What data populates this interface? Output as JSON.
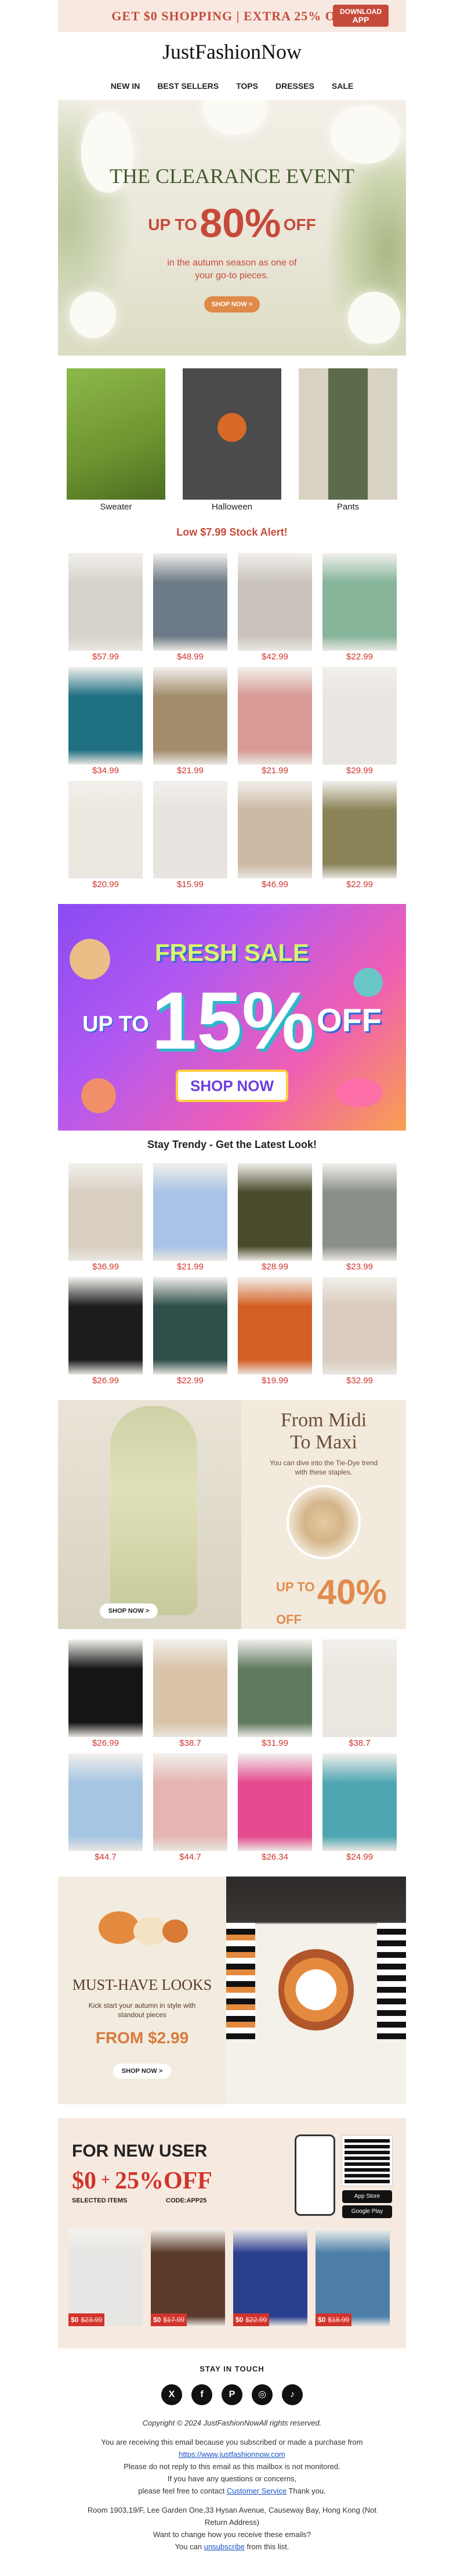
{
  "topbar": {
    "promo": "GET $0 SHOPPING | EXTRA 25% OFF",
    "download_line1": "DOWNLOAD",
    "download_line2": "APP"
  },
  "brand": "JustFashionNow",
  "nav": [
    "NEW IN",
    "BEST SELLERS",
    "TOPS",
    "DRESSES",
    "SALE"
  ],
  "hero": {
    "title": "THE CLEARANCE EVENT",
    "upto": "UP TO",
    "percent": "80%",
    "off": "OFF",
    "subtitle_1": "in the autumn season as one of",
    "subtitle_2": "your go-to pieces.",
    "button": "SHOP NOW >"
  },
  "categories": [
    {
      "label": "Sweater",
      "color": "#7aa238"
    },
    {
      "label": "Halloween",
      "color": "#4b4a4c"
    },
    {
      "label": "Pants",
      "color": "#5e6a4c"
    }
  ],
  "stock_alert": "Low $7.99 Stock Alert!",
  "stock_products": [
    {
      "price": "$57.99",
      "color": "#d7d3cc"
    },
    {
      "price": "$48.99",
      "color": "#6b7a86"
    },
    {
      "price": "$42.99",
      "color": "#c9c3bc"
    },
    {
      "price": "$22.99",
      "color": "#86b59a"
    },
    {
      "price": "$34.99",
      "color": "#1f6f83"
    },
    {
      "price": "$21.99",
      "color": "#a38c6c"
    },
    {
      "price": "$21.99",
      "color": "#d89a95"
    },
    {
      "price": "$29.99",
      "color": "#e9e5e1"
    },
    {
      "price": "$20.99",
      "color": "#ede8df"
    },
    {
      "price": "$15.99",
      "color": "#e7e4df"
    },
    {
      "price": "$46.99",
      "color": "#cbb9a3"
    },
    {
      "price": "$22.99",
      "color": "#8a8358"
    }
  ],
  "fresh_sale": {
    "title": "FRESH SALE",
    "upto": "UP TO",
    "percent": "15%",
    "off": "OFF",
    "button": "SHOP NOW"
  },
  "trendy_heading": "Stay Trendy - Get the Latest Look!",
  "trendy_products": [
    {
      "price": "$36.99",
      "color": "#d8cfc1"
    },
    {
      "price": "$21.99",
      "color": "#a9c3e6"
    },
    {
      "price": "$28.99",
      "color": "#4a4b2c"
    },
    {
      "price": "$23.99",
      "color": "#8a8f8a"
    },
    {
      "price": "$26.99",
      "color": "#1c1c1c"
    },
    {
      "price": "$22.99",
      "color": "#2f4f4a"
    },
    {
      "price": "$19.99",
      "color": "#d45f24"
    },
    {
      "price": "$32.99",
      "color": "#d9cbbd"
    }
  ],
  "midi": {
    "title_1": "From Midi",
    "title_2": "To Maxi",
    "subtitle": "You can dive into the Tie-Dye trend with these staples.",
    "upto": "UP TO",
    "percent": "40%",
    "off": "OFF",
    "left_button": "SHOP NOW >"
  },
  "midi_products": [
    {
      "price": "$26.99",
      "color": "#151515"
    },
    {
      "price": "$38.7",
      "color": "#d9c3a8"
    },
    {
      "price": "$31.99",
      "color": "#5f7a5e"
    },
    {
      "price": "$38.7",
      "color": "#ece7df"
    },
    {
      "price": "$44.7",
      "color": "#a6c5e2"
    },
    {
      "price": "$44.7",
      "color": "#e5b5b2"
    },
    {
      "price": "$26.34",
      "color": "#e54b8e"
    },
    {
      "price": "$24.99",
      "color": "#4fa6b3"
    }
  ],
  "must_have": {
    "title": "MUST-HAVE LOOKS",
    "subtitle": "Kick start your autumn in style with standout pieces",
    "from": "FROM $2.99",
    "button": "SHOP NOW >"
  },
  "new_user": {
    "title": "FOR NEW USER",
    "zero": "$0",
    "plus": "+",
    "discount": "25%OFF",
    "label_1": "SELECTED ITEMS",
    "label_2": "CODE:APP25",
    "app_store": "App Store",
    "google_play": "Google Play",
    "products": [
      {
        "now": "$0",
        "was": "$23.99",
        "color": "#e7e6e4"
      },
      {
        "now": "$0",
        "was": "$17.99",
        "color": "#5a3a2a"
      },
      {
        "now": "$0",
        "was": "$22.99",
        "color": "#2b3f8f"
      },
      {
        "now": "$0",
        "was": "$18.99",
        "color": "#4d7fa8"
      }
    ]
  },
  "footer": {
    "stay_in_touch": "STAY IN TOUCH",
    "social": [
      "X",
      "f",
      "P",
      "◎",
      "♪"
    ],
    "copyright": "Copyright © 2024 JustFashionNowAll rights reserved.",
    "line1": "You are receiving this email because you subscribed or made a purchase from",
    "link": "https://www.justfashionnow.com",
    "line2": "Please do not reply to this email as this mailbox is not monitored.",
    "line3": "If you have any questions or concerns,",
    "line4_pre": "please feel free to contact",
    "line4_link": "Customer Service",
    "line4_post": "Thank you.",
    "address": "Room 1903,19/F, Lee Garden One,33 Hysan Avenue, Causeway Bay, Hong Kong (Not Return Address)",
    "line5": "Want to change how you receive these emails?",
    "line6_pre": "You can",
    "line6_link": "unsubscribe",
    "line6_post": "from this list."
  }
}
